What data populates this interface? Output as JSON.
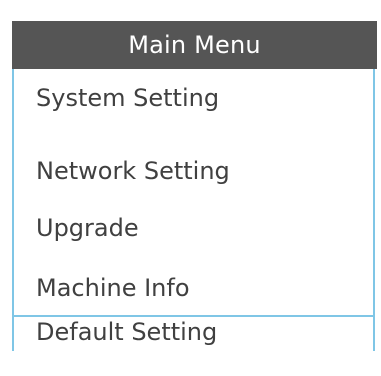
{
  "menu": {
    "title": "Main Menu",
    "items": [
      {
        "label": "System Setting"
      },
      {
        "label": "Network Setting"
      },
      {
        "label": "Upgrade"
      },
      {
        "label": "Machine Info"
      },
      {
        "label": "Default Setting"
      }
    ]
  },
  "colors": {
    "header_bg": "#555555",
    "header_text": "#ffffff",
    "item_text": "#404040",
    "border": "#7fc6e6"
  }
}
